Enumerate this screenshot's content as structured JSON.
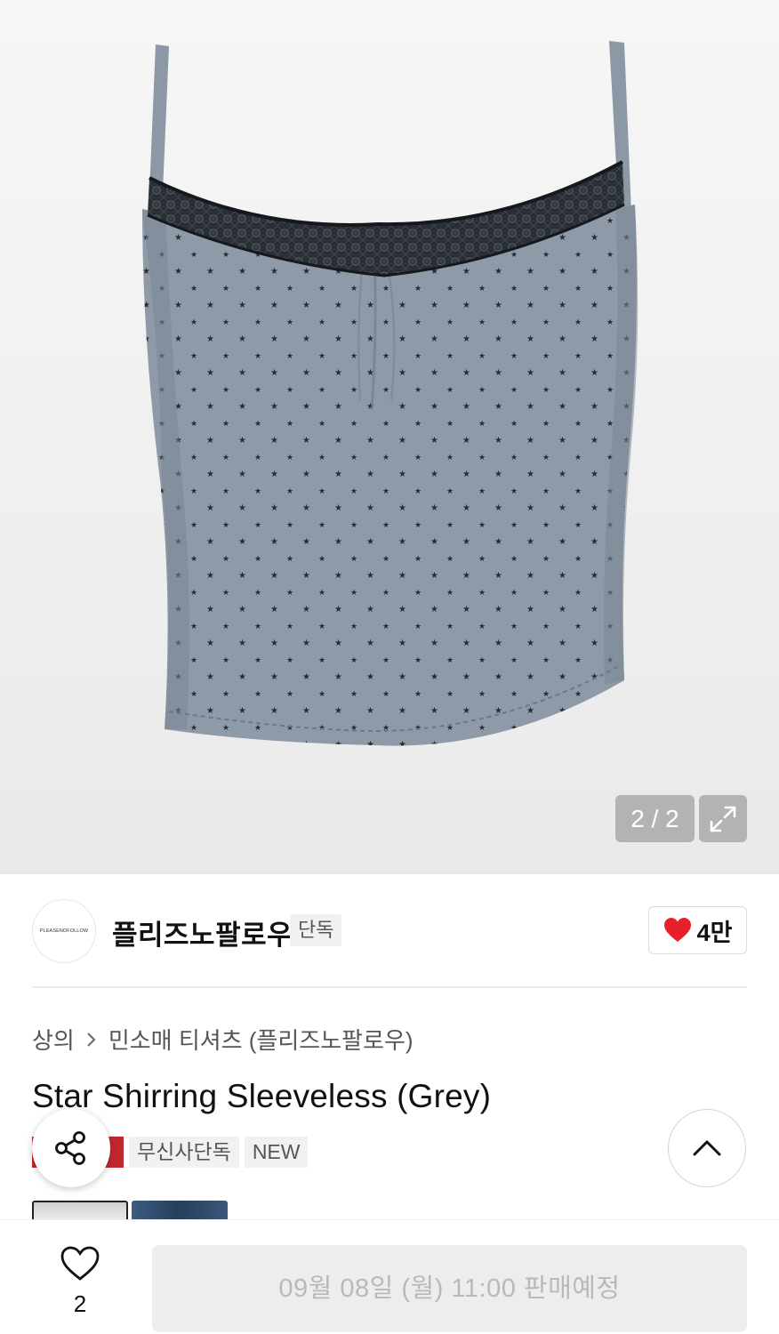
{
  "gallery": {
    "counter": "2 / 2",
    "expand_icon": "expand-arrows-icon"
  },
  "brand": {
    "logo_text": "PLEASENOFOLLOW",
    "name": "플리즈노팔로우",
    "badge": "단독",
    "like_count": "4만",
    "like_color": "#e8202a"
  },
  "breadcrumb": {
    "category": "상의",
    "subcategory": "민소매 티셔츠 (플리즈노팔로우)"
  },
  "product": {
    "title": "Star Shirring Sleeveless (Grey)",
    "tags": [
      "무신사단독",
      "NEW"
    ]
  },
  "bottom_bar": {
    "wish_count": "2",
    "sale_button": "09월 08일 (월) 11:00 판매예정"
  },
  "colors": {
    "tag_red": "#c0282d",
    "garment": "#8f9aa8",
    "lace": "#1f232a"
  }
}
